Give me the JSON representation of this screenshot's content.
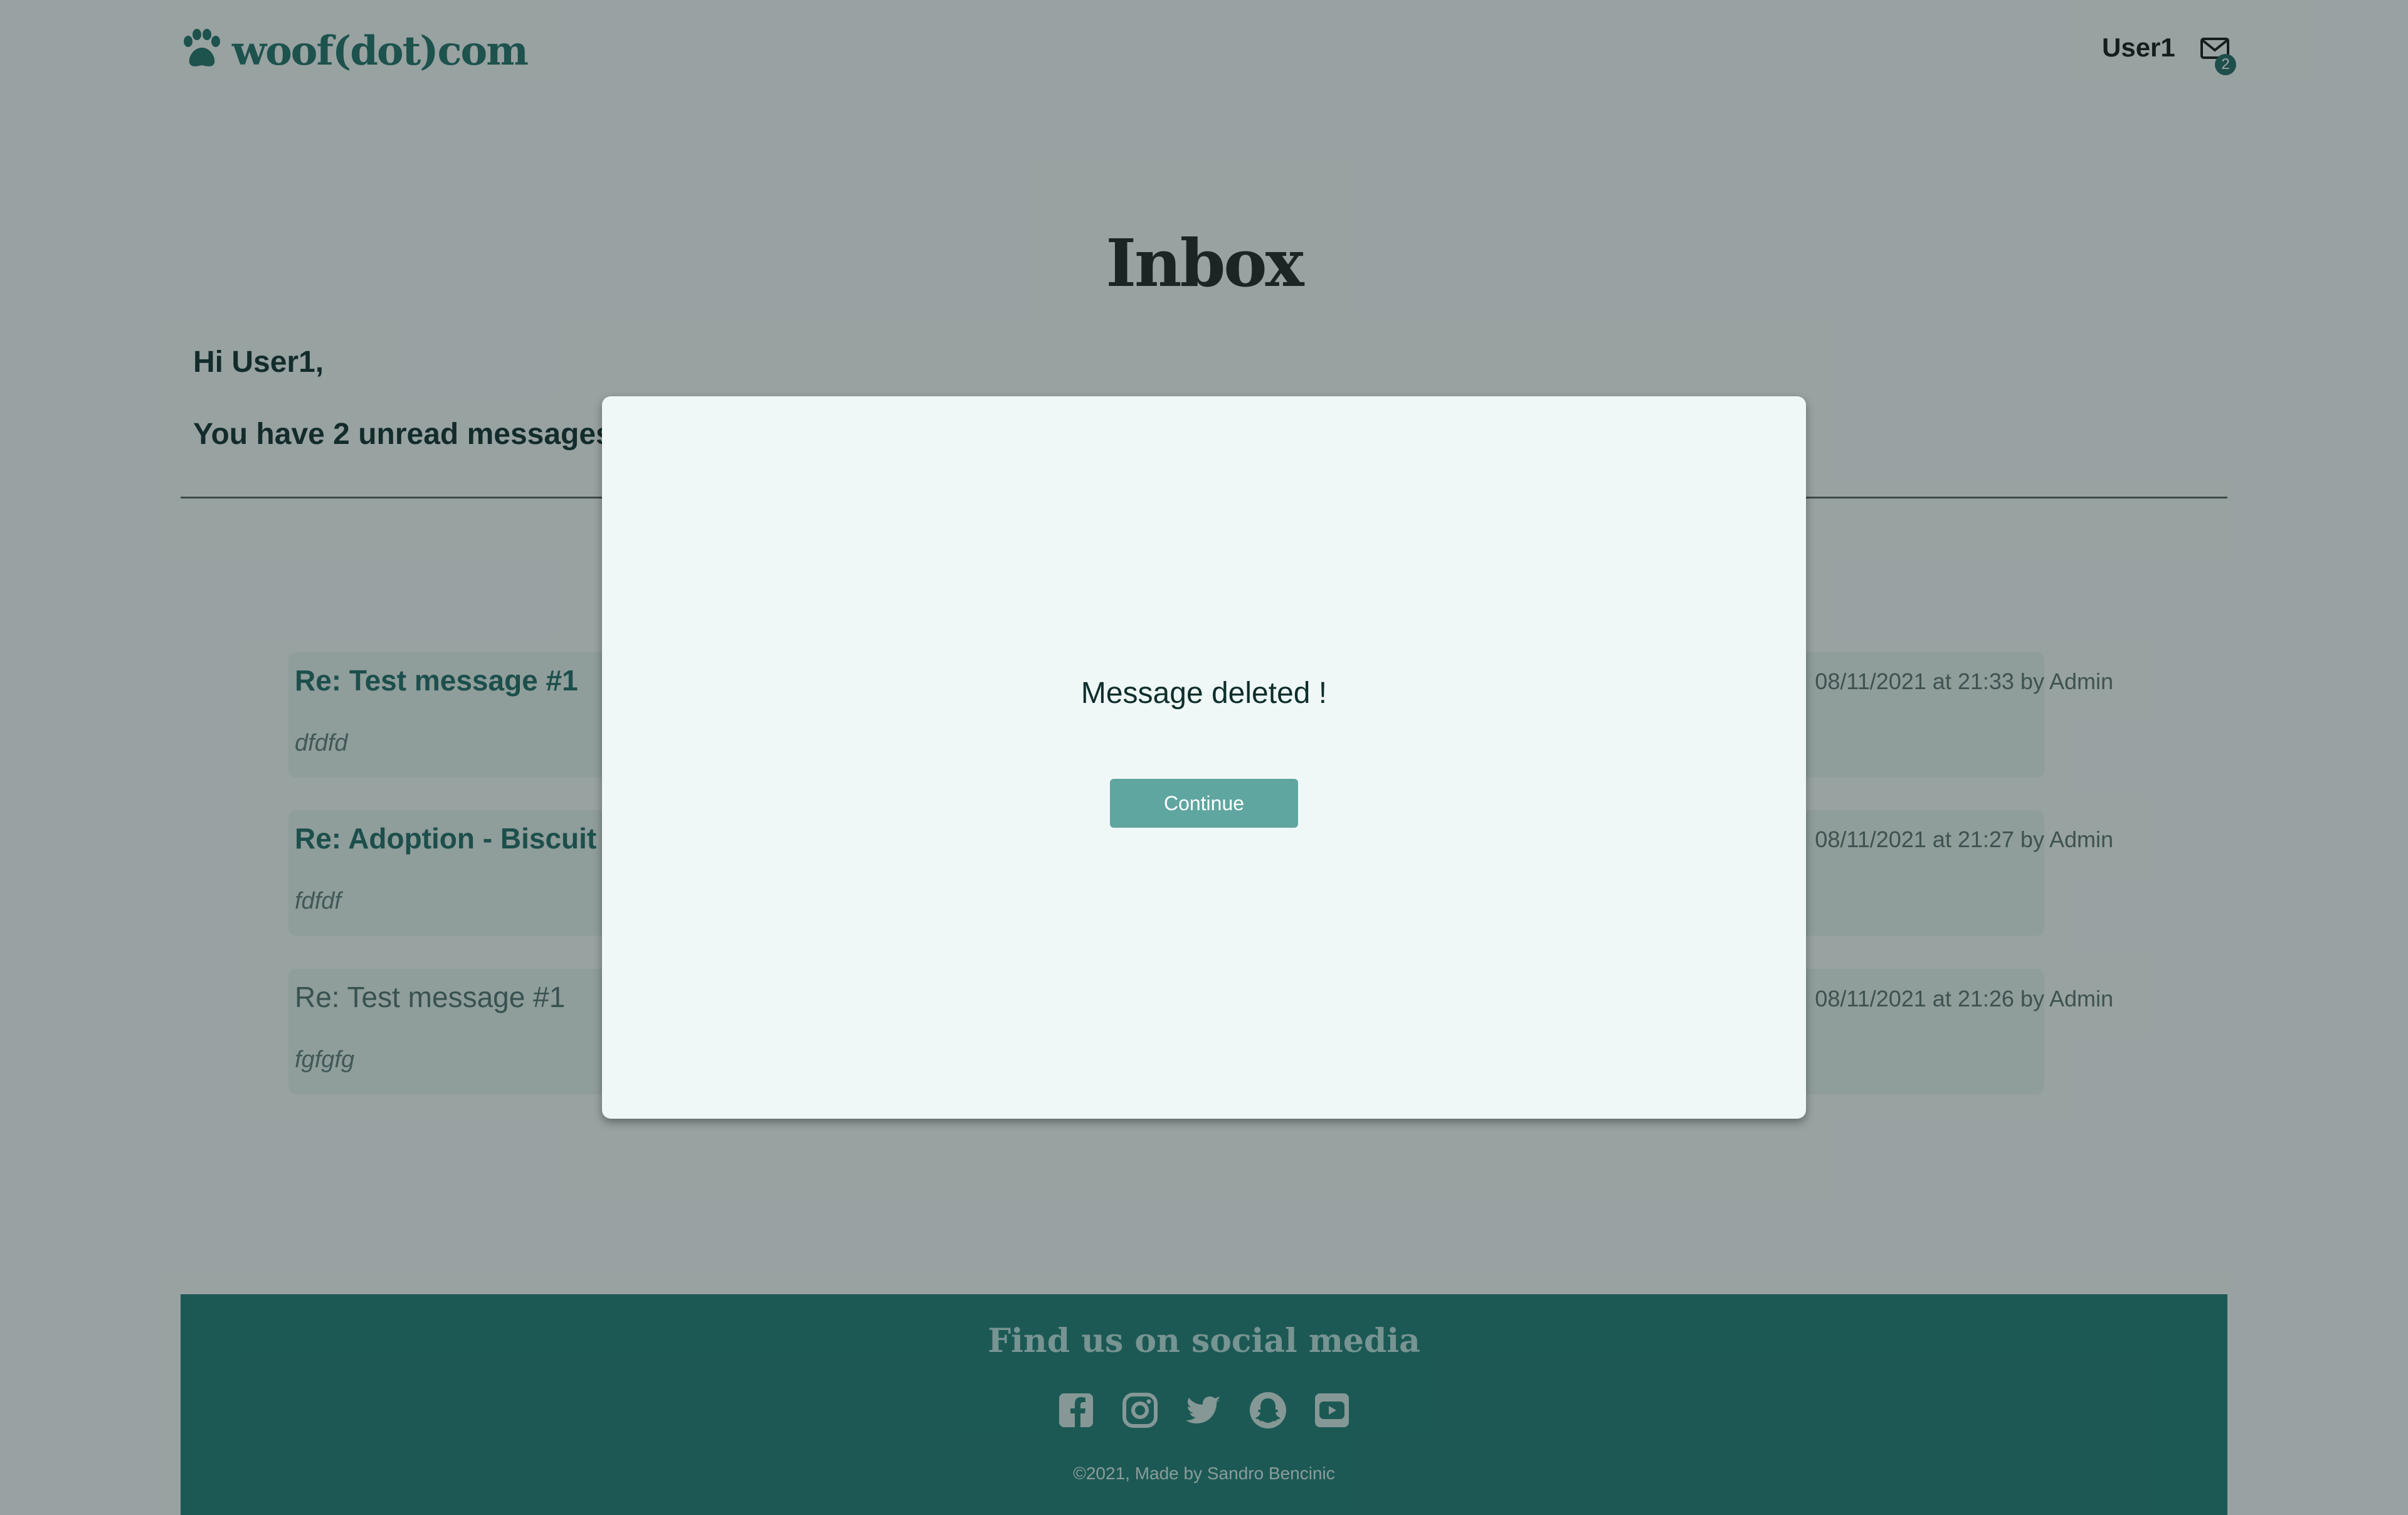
{
  "header": {
    "logo_text": "woof(dot)com",
    "username": "User1",
    "mail_count": "2"
  },
  "inbox": {
    "title": "Inbox",
    "greeting": "Hi User1,",
    "unread_text": "You have 2 unread messages",
    "messages": [
      {
        "subject": "Re: Test message #1",
        "preview": "dfdfd",
        "meta": "08/11/2021 at 21:33 by Admin",
        "unread": true
      },
      {
        "subject": "Re: Adoption - Biscuit",
        "preview": "fdfdf",
        "meta": "08/11/2021 at 21:27 by Admin",
        "unread": true
      },
      {
        "subject": "Re: Test message #1",
        "preview": "fgfgfg",
        "meta": "08/11/2021 at 21:26 by Admin",
        "unread": false
      }
    ]
  },
  "footer": {
    "title": "Find us on social media",
    "social_icons": [
      "facebook-icon",
      "instagram-icon",
      "twitter-icon",
      "snapchat-icon",
      "youtube-icon"
    ],
    "copyright": "©2021, Made by Sandro Bencinic"
  },
  "modal": {
    "message": "Message deleted !",
    "button_label": "Continue"
  },
  "colors": {
    "brand": "#1a7a73",
    "accent_button": "#5fa6a0",
    "background": "#f0f8f7"
  }
}
